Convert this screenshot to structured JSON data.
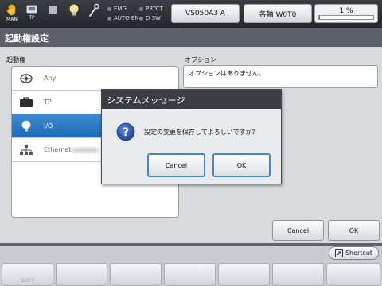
{
  "topbar": {
    "icons": [
      {
        "name": "hand-icon",
        "caption": "MAN"
      },
      {
        "name": "teach-pendant-icon",
        "caption": "TP"
      },
      {
        "name": "stop-square-icon",
        "caption": ""
      },
      {
        "name": "bulb-icon",
        "caption": ""
      },
      {
        "name": "wrench-icon",
        "caption": ""
      }
    ],
    "status": {
      "emg": "EMG",
      "prtct": "PRTCT",
      "auto_en": "AUTO EN",
      "d_sw": "D SW"
    },
    "robot_label": "VS050A3 A",
    "axis_label": "各軸 W0T0",
    "speed_text": "1 %",
    "speed_fraction": 0.01
  },
  "title": "起動権設定",
  "list": {
    "label": "起動権",
    "items": [
      {
        "label": "Any",
        "icon": "globe-icon"
      },
      {
        "label": "TP",
        "icon": "teach-pendant-icon"
      },
      {
        "label": "I/O",
        "icon": "bulb-icon"
      },
      {
        "label": "Ethernet",
        "icon": "network-icon"
      }
    ]
  },
  "option": {
    "label": "オプション",
    "text": "オプションはありません。"
  },
  "dialog": {
    "title": "システムメッセージ",
    "message": "設定の変更を保存してよろしいですか？",
    "cancel": "Cancel",
    "ok": "OK"
  },
  "actions": {
    "cancel": "Cancel",
    "ok": "OK"
  },
  "shortcut": "Shortcut",
  "fkeys": [
    "SHIFT",
    "",
    "",
    "",
    "",
    "",
    ""
  ],
  "colors": {
    "selection": "#2a78c2",
    "dialog_title": "#3a3d42",
    "focus_border": "#4a84c9"
  }
}
